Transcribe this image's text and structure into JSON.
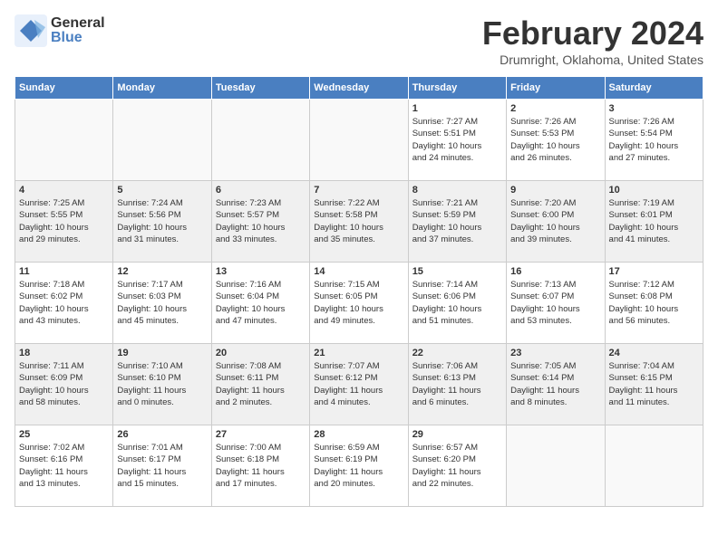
{
  "header": {
    "logo_general": "General",
    "logo_blue": "Blue",
    "month_title": "February 2024",
    "location": "Drumright, Oklahoma, United States"
  },
  "weekdays": [
    "Sunday",
    "Monday",
    "Tuesday",
    "Wednesday",
    "Thursday",
    "Friday",
    "Saturday"
  ],
  "weeks": [
    [
      {
        "day": "",
        "info": ""
      },
      {
        "day": "",
        "info": ""
      },
      {
        "day": "",
        "info": ""
      },
      {
        "day": "",
        "info": ""
      },
      {
        "day": "1",
        "info": "Sunrise: 7:27 AM\nSunset: 5:51 PM\nDaylight: 10 hours\nand 24 minutes."
      },
      {
        "day": "2",
        "info": "Sunrise: 7:26 AM\nSunset: 5:53 PM\nDaylight: 10 hours\nand 26 minutes."
      },
      {
        "day": "3",
        "info": "Sunrise: 7:26 AM\nSunset: 5:54 PM\nDaylight: 10 hours\nand 27 minutes."
      }
    ],
    [
      {
        "day": "4",
        "info": "Sunrise: 7:25 AM\nSunset: 5:55 PM\nDaylight: 10 hours\nand 29 minutes."
      },
      {
        "day": "5",
        "info": "Sunrise: 7:24 AM\nSunset: 5:56 PM\nDaylight: 10 hours\nand 31 minutes."
      },
      {
        "day": "6",
        "info": "Sunrise: 7:23 AM\nSunset: 5:57 PM\nDaylight: 10 hours\nand 33 minutes."
      },
      {
        "day": "7",
        "info": "Sunrise: 7:22 AM\nSunset: 5:58 PM\nDaylight: 10 hours\nand 35 minutes."
      },
      {
        "day": "8",
        "info": "Sunrise: 7:21 AM\nSunset: 5:59 PM\nDaylight: 10 hours\nand 37 minutes."
      },
      {
        "day": "9",
        "info": "Sunrise: 7:20 AM\nSunset: 6:00 PM\nDaylight: 10 hours\nand 39 minutes."
      },
      {
        "day": "10",
        "info": "Sunrise: 7:19 AM\nSunset: 6:01 PM\nDaylight: 10 hours\nand 41 minutes."
      }
    ],
    [
      {
        "day": "11",
        "info": "Sunrise: 7:18 AM\nSunset: 6:02 PM\nDaylight: 10 hours\nand 43 minutes."
      },
      {
        "day": "12",
        "info": "Sunrise: 7:17 AM\nSunset: 6:03 PM\nDaylight: 10 hours\nand 45 minutes."
      },
      {
        "day": "13",
        "info": "Sunrise: 7:16 AM\nSunset: 6:04 PM\nDaylight: 10 hours\nand 47 minutes."
      },
      {
        "day": "14",
        "info": "Sunrise: 7:15 AM\nSunset: 6:05 PM\nDaylight: 10 hours\nand 49 minutes."
      },
      {
        "day": "15",
        "info": "Sunrise: 7:14 AM\nSunset: 6:06 PM\nDaylight: 10 hours\nand 51 minutes."
      },
      {
        "day": "16",
        "info": "Sunrise: 7:13 AM\nSunset: 6:07 PM\nDaylight: 10 hours\nand 53 minutes."
      },
      {
        "day": "17",
        "info": "Sunrise: 7:12 AM\nSunset: 6:08 PM\nDaylight: 10 hours\nand 56 minutes."
      }
    ],
    [
      {
        "day": "18",
        "info": "Sunrise: 7:11 AM\nSunset: 6:09 PM\nDaylight: 10 hours\nand 58 minutes."
      },
      {
        "day": "19",
        "info": "Sunrise: 7:10 AM\nSunset: 6:10 PM\nDaylight: 11 hours\nand 0 minutes."
      },
      {
        "day": "20",
        "info": "Sunrise: 7:08 AM\nSunset: 6:11 PM\nDaylight: 11 hours\nand 2 minutes."
      },
      {
        "day": "21",
        "info": "Sunrise: 7:07 AM\nSunset: 6:12 PM\nDaylight: 11 hours\nand 4 minutes."
      },
      {
        "day": "22",
        "info": "Sunrise: 7:06 AM\nSunset: 6:13 PM\nDaylight: 11 hours\nand 6 minutes."
      },
      {
        "day": "23",
        "info": "Sunrise: 7:05 AM\nSunset: 6:14 PM\nDaylight: 11 hours\nand 8 minutes."
      },
      {
        "day": "24",
        "info": "Sunrise: 7:04 AM\nSunset: 6:15 PM\nDaylight: 11 hours\nand 11 minutes."
      }
    ],
    [
      {
        "day": "25",
        "info": "Sunrise: 7:02 AM\nSunset: 6:16 PM\nDaylight: 11 hours\nand 13 minutes."
      },
      {
        "day": "26",
        "info": "Sunrise: 7:01 AM\nSunset: 6:17 PM\nDaylight: 11 hours\nand 15 minutes."
      },
      {
        "day": "27",
        "info": "Sunrise: 7:00 AM\nSunset: 6:18 PM\nDaylight: 11 hours\nand 17 minutes."
      },
      {
        "day": "28",
        "info": "Sunrise: 6:59 AM\nSunset: 6:19 PM\nDaylight: 11 hours\nand 20 minutes."
      },
      {
        "day": "29",
        "info": "Sunrise: 6:57 AM\nSunset: 6:20 PM\nDaylight: 11 hours\nand 22 minutes."
      },
      {
        "day": "",
        "info": ""
      },
      {
        "day": "",
        "info": ""
      }
    ]
  ]
}
